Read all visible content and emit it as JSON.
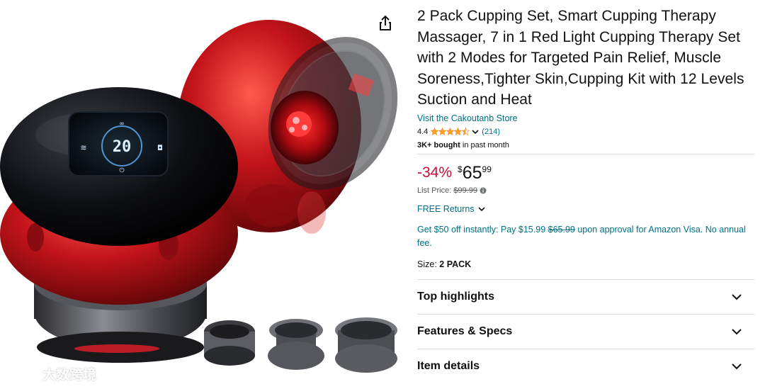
{
  "product": {
    "title": "2 Pack Cupping Set, Smart Cupping Therapy Massager, 7 in 1 Red Light Cupping Therapy Set with 2 Modes for Targeted Pain Relief, Muscle Soreness,Tighter Skin,Cupping Kit with 12 Levels Suction and Heat",
    "store_link": "Visit the Cakoutanb Store",
    "rating": "4.4",
    "rating_count": "(214)",
    "bought_bold": "3K+ bought",
    "bought_rest": " in past month",
    "device_display": "20",
    "watermark": "大数跨境"
  },
  "price": {
    "discount": "-34%",
    "symbol": "$",
    "whole": "65",
    "fraction": "99",
    "list_label": "List Price:",
    "list_value": "$99.99"
  },
  "returns": {
    "label": "FREE Returns"
  },
  "offer": {
    "text_before": "Get $50 off instantly: Pay $15.99 ",
    "strike": "$65.99",
    "text_after": " upon approval for Amazon Visa. No annual fee."
  },
  "size": {
    "label": "Size:",
    "value": "2 PACK"
  },
  "sections": [
    {
      "label": "Top highlights"
    },
    {
      "label": "Features & Specs"
    },
    {
      "label": "Item details"
    }
  ],
  "colors": {
    "link": "#007185",
    "discount": "#cc0c39",
    "star": "#ffa41c",
    "divider": "#dddddd"
  },
  "icons": [
    "share-icon",
    "star-icon",
    "chevron-down-icon",
    "info-icon"
  ]
}
